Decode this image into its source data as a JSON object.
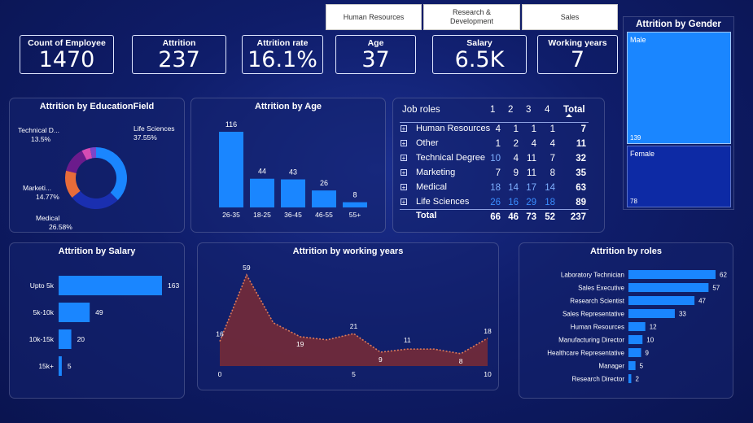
{
  "slicers": [
    "Human Resources",
    "Research & Development",
    "Sales"
  ],
  "kpis": [
    {
      "label": "Count of Employee",
      "value": "1470"
    },
    {
      "label": "Attrition",
      "value": "237"
    },
    {
      "label": "Attrition rate",
      "value": "16.1%"
    },
    {
      "label": "Age",
      "value": "37"
    },
    {
      "label": "Salary",
      "value": "6.5K"
    },
    {
      "label": "Working years",
      "value": "7"
    }
  ],
  "colors": {
    "bar": "#1a86ff",
    "area": "#7a2b35",
    "area_line": "#e07b5a",
    "gender_male": "#1a86ff",
    "gender_female": "#0d2aa5"
  },
  "chart_data": [
    {
      "id": "education",
      "type": "pie",
      "title": "Attrition by EducationField",
      "slices": [
        {
          "label": "Life Sciences",
          "pct_label": "37.55%",
          "value": 37.55,
          "color": "#1a86ff"
        },
        {
          "label": "Medical",
          "pct_label": "26.58%",
          "value": 26.58,
          "color": "#1a2fb0"
        },
        {
          "label": "Marketi...",
          "pct_label": "14.77%",
          "value": 14.77,
          "color": "#e86c3a"
        },
        {
          "label": "Technical D...",
          "pct_label": "13.5%",
          "value": 13.5,
          "color": "#6b1b8c"
        },
        {
          "label": "",
          "pct_label": "",
          "value": 4.5,
          "color": "#d64bb4"
        },
        {
          "label": "",
          "pct_label": "",
          "value": 3.1,
          "color": "#7b46c8"
        }
      ]
    },
    {
      "id": "age",
      "type": "bar",
      "title": "Attrition by Age",
      "categories": [
        "26-35",
        "18-25",
        "36-45",
        "46-55",
        "55+"
      ],
      "values": [
        116,
        44,
        43,
        26,
        8
      ],
      "ylim": [
        0,
        116
      ]
    },
    {
      "id": "salary",
      "type": "bar",
      "orientation": "horizontal",
      "title": "Attrition by Salary",
      "categories": [
        "Upto 5k",
        "5k-10k",
        "10k-15k",
        "15k+"
      ],
      "values": [
        163,
        49,
        20,
        5
      ],
      "xlim": [
        0,
        163
      ]
    },
    {
      "id": "years",
      "type": "area",
      "title": "Attrition by working years",
      "x": [
        0,
        1,
        2,
        3,
        4,
        5,
        6,
        7,
        8,
        9,
        10
      ],
      "values": [
        16,
        59,
        28,
        19,
        17,
        21,
        9,
        11,
        11,
        8,
        18
      ],
      "labels": [
        {
          "i": 0,
          "v": "16"
        },
        {
          "i": 1,
          "v": "59"
        },
        {
          "i": 3,
          "v": "19"
        },
        {
          "i": 5,
          "v": "21"
        },
        {
          "i": 6,
          "v": "9"
        },
        {
          "i": 7,
          "v": "11"
        },
        {
          "i": 9,
          "v": "8"
        },
        {
          "i": 10,
          "v": "18"
        }
      ],
      "xticks": [
        "0",
        "5",
        "10"
      ],
      "ylim": [
        0,
        59
      ]
    },
    {
      "id": "roles",
      "type": "bar",
      "orientation": "horizontal",
      "title": "Attrition by roles",
      "categories": [
        "Laboratory Technician",
        "Sales Executive",
        "Research Scientist",
        "Sales Representative",
        "Human Resources",
        "Manufacturing Director",
        "Healthcare Representative",
        "Manager",
        "Research Director"
      ],
      "values": [
        62,
        57,
        47,
        33,
        12,
        10,
        9,
        5,
        2
      ],
      "xlim": [
        0,
        62
      ]
    },
    {
      "id": "gender",
      "type": "table",
      "title": "Attrition by Gender",
      "rows": [
        {
          "label": "Male",
          "value": 139
        },
        {
          "label": "Female",
          "value": 78
        }
      ]
    },
    {
      "id": "jobroles",
      "type": "table",
      "title": "Job roles",
      "columns": [
        "1",
        "2",
        "3",
        "4",
        "Total"
      ],
      "rows": [
        {
          "label": "Human Resources",
          "values": [
            "4",
            "1",
            "1",
            "1",
            "7"
          ]
        },
        {
          "label": "Other",
          "values": [
            "1",
            "2",
            "4",
            "4",
            "11"
          ]
        },
        {
          "label": "Technical Degree",
          "values": [
            "10",
            "4",
            "11",
            "7",
            "32"
          ]
        },
        {
          "label": "Marketing",
          "values": [
            "7",
            "9",
            "11",
            "8",
            "35"
          ]
        },
        {
          "label": "Medical",
          "values": [
            "18",
            "14",
            "17",
            "14",
            "63"
          ]
        },
        {
          "label": "Life Sciences",
          "values": [
            "26",
            "16",
            "29",
            "18",
            "89"
          ]
        }
      ],
      "total": {
        "label": "Total",
        "values": [
          "66",
          "46",
          "73",
          "52",
          "237"
        ]
      }
    }
  ]
}
